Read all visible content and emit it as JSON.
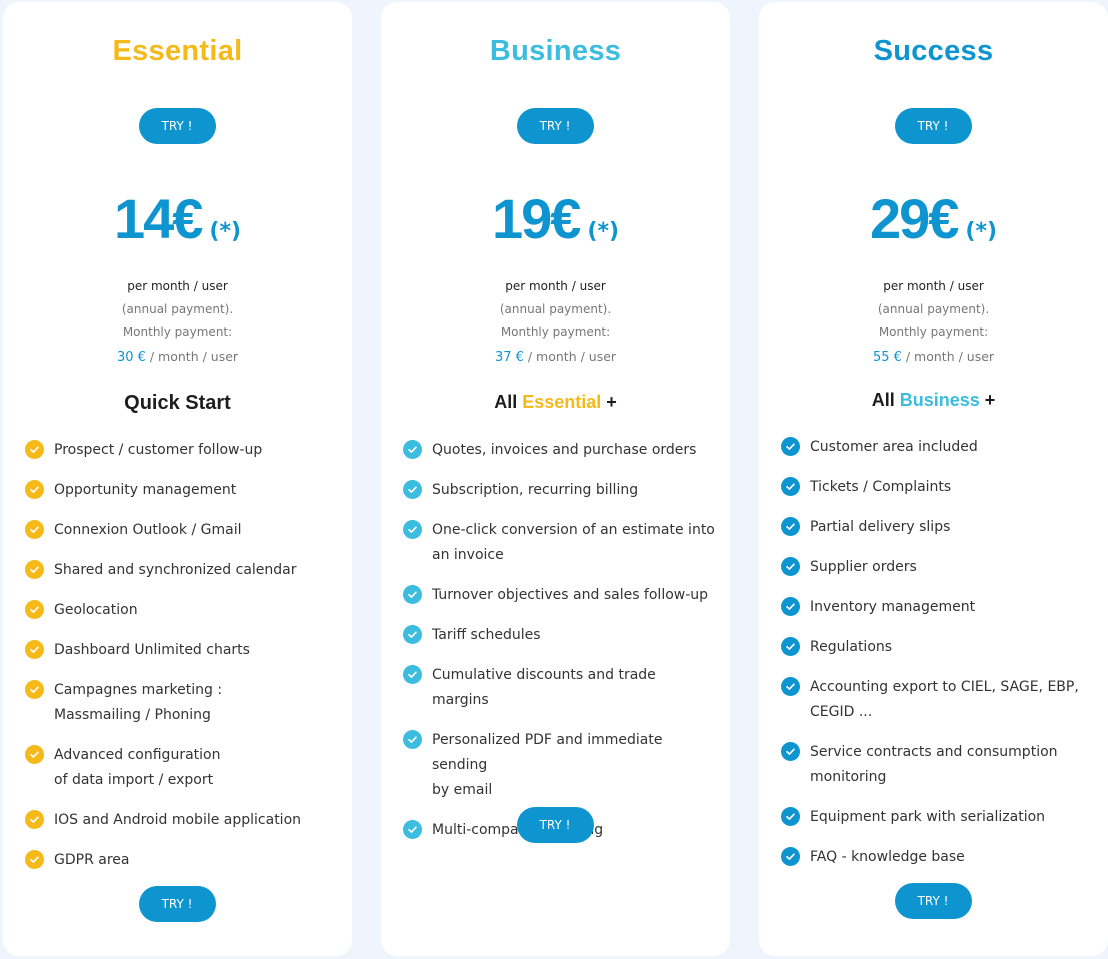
{
  "colors": {
    "essential": "#f5b919",
    "business": "#3cbde0",
    "success": "#0e95d0",
    "button": "#0e95d0",
    "price": "#0e95d0",
    "background": "#eef5fd"
  },
  "plans": [
    {
      "title": "Essential",
      "title_color": "#f5b919",
      "try_label_top": "TRY !",
      "price": "14€",
      "price_note": "(*)",
      "per_line": "per month / user",
      "annual_line": "(annual payment).",
      "monthly_label": "Monthly payment:",
      "monthly_amount": "30 €",
      "monthly_suffix": " / month / user",
      "section": {
        "prefix": "Quick Start",
        "highlight": "",
        "suffix": "",
        "highlight_color": ""
      },
      "check_icon": "check-circle-icon",
      "check_color": "#f5b919",
      "features": [
        "Prospect / customer follow-up",
        "Opportunity management",
        "Connexion Outlook / Gmail",
        "Shared and synchronized calendar",
        "Geolocation",
        "Dashboard Unlimited charts",
        "Campagnes marketing :\nMassmailing / Phoning",
        "Advanced configuration\nof data import / export",
        "IOS and Android mobile application",
        "GDPR area"
      ],
      "try_label_bottom": "TRY !"
    },
    {
      "title": "Business",
      "title_color": "#3cbde0",
      "try_label_top": "TRY !",
      "price": "19€",
      "price_note": "(*)",
      "per_line": "per month / user",
      "annual_line": "(annual payment).",
      "monthly_label": "Monthly payment:",
      "monthly_amount": "37 €",
      "monthly_suffix": " / month / user",
      "section": {
        "prefix": "All ",
        "highlight": "Essential",
        "suffix": " +",
        "highlight_color": "#f5b919"
      },
      "check_icon": "check-circle-icon",
      "check_color": "#3cbde0",
      "features": [
        "Quotes, invoices and purchase orders",
        "Subscription, recurring billing",
        "One-click conversion of an estimate into\nan invoice",
        "Turnover objectives and sales follow-up",
        "Tariff schedules",
        "Cumulative discounts and trade margins",
        "Personalized PDF and immediate sending\nby email",
        "Multi-company invoicing"
      ],
      "try_label_bottom": "TRY !"
    },
    {
      "title": "Success",
      "title_color": "#0e95d0",
      "try_label_top": "TRY !",
      "price": "29€",
      "price_note": "(*)",
      "per_line": "per month / user",
      "annual_line": "(annual payment).",
      "monthly_label": "Monthly payment:",
      "monthly_amount": "55 €",
      "monthly_suffix": " / month / user",
      "section": {
        "prefix": "All ",
        "highlight": "Business",
        "suffix": " +",
        "highlight_color": "#3cbde0"
      },
      "check_icon": "check-circle-icon",
      "check_color": "#0e95d0",
      "features": [
        "Customer area included",
        "Tickets / Complaints",
        "Partial delivery slips",
        "Supplier orders",
        "Inventory management",
        "Regulations",
        "Accounting export to CIEL, SAGE, EBP,\nCEGID ...",
        "Service contracts and consumption\nmonitoring",
        "Equipment park with serialization",
        "FAQ - knowledge base"
      ],
      "try_label_bottom": "TRY !"
    }
  ]
}
